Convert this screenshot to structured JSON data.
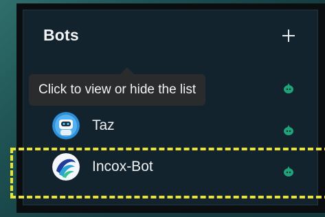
{
  "panel": {
    "title": "Bots",
    "add_button_icon": "plus-icon"
  },
  "tooltip": {
    "text": "Click to view or hide the list"
  },
  "bots": [
    {
      "name": "Taz",
      "avatar_icon": "robot-avatar-icon",
      "status_icon": "green-bot-status-icon"
    },
    {
      "name": "Incox-Bot",
      "avatar_icon": "incox-swirl-avatar-icon",
      "status_icon": "green-bot-status-icon"
    }
  ],
  "colors": {
    "panel_bg": "#13232d",
    "status_green": "#1fa37a",
    "highlight_dash": "#e8e431"
  }
}
